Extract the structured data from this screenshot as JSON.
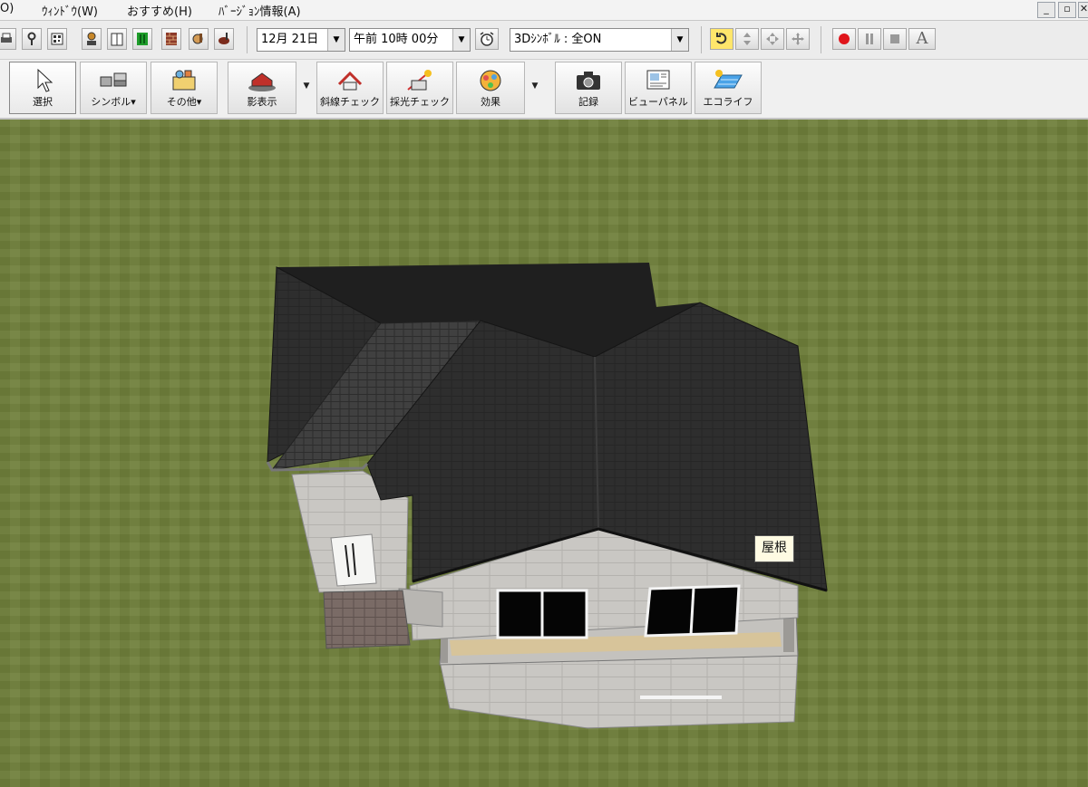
{
  "menu": {
    "items": [
      "O)",
      "ｳｨﾝﾄﾞｳ(W)",
      "おすすめ(H)",
      "ﾊﾞｰｼﾞｮﾝ情報(A)"
    ]
  },
  "window_controls": {
    "minimize": "_",
    "restore": "▫",
    "close": "✕"
  },
  "toolbar": {
    "date_value": "12月 21日",
    "time_value": "午前 10時 00分",
    "symbol_value": "3Dｼﾝﾎﾞﾙ : 全ON",
    "text_button": "A"
  },
  "tools": [
    {
      "label": "選択",
      "icon": "cursor-icon"
    },
    {
      "label": "シンボル▾",
      "icon": "furniture-icon"
    },
    {
      "label": "その他▾",
      "icon": "misc-box-icon"
    },
    {
      "label": "影表示",
      "icon": "shadow-house-icon"
    },
    {
      "label": "斜線チェック",
      "icon": "slant-line-house-icon"
    },
    {
      "label": "採光チェック",
      "icon": "daylight-check-icon"
    },
    {
      "label": "効果",
      "icon": "effects-icon"
    },
    {
      "label": "記録",
      "icon": "camera-icon"
    },
    {
      "label": "ビューパネル",
      "icon": "view-panel-icon"
    },
    {
      "label": "エコライフ",
      "icon": "eco-life-icon"
    }
  ],
  "viewport": {
    "roof_label": "屋根"
  },
  "colors": {
    "grass": "#6f7f3b",
    "roof": "#2b2b2b",
    "wall": "#c9c7c3",
    "balcony_deck": "#d7c49a",
    "record_button": "#e0151b"
  }
}
